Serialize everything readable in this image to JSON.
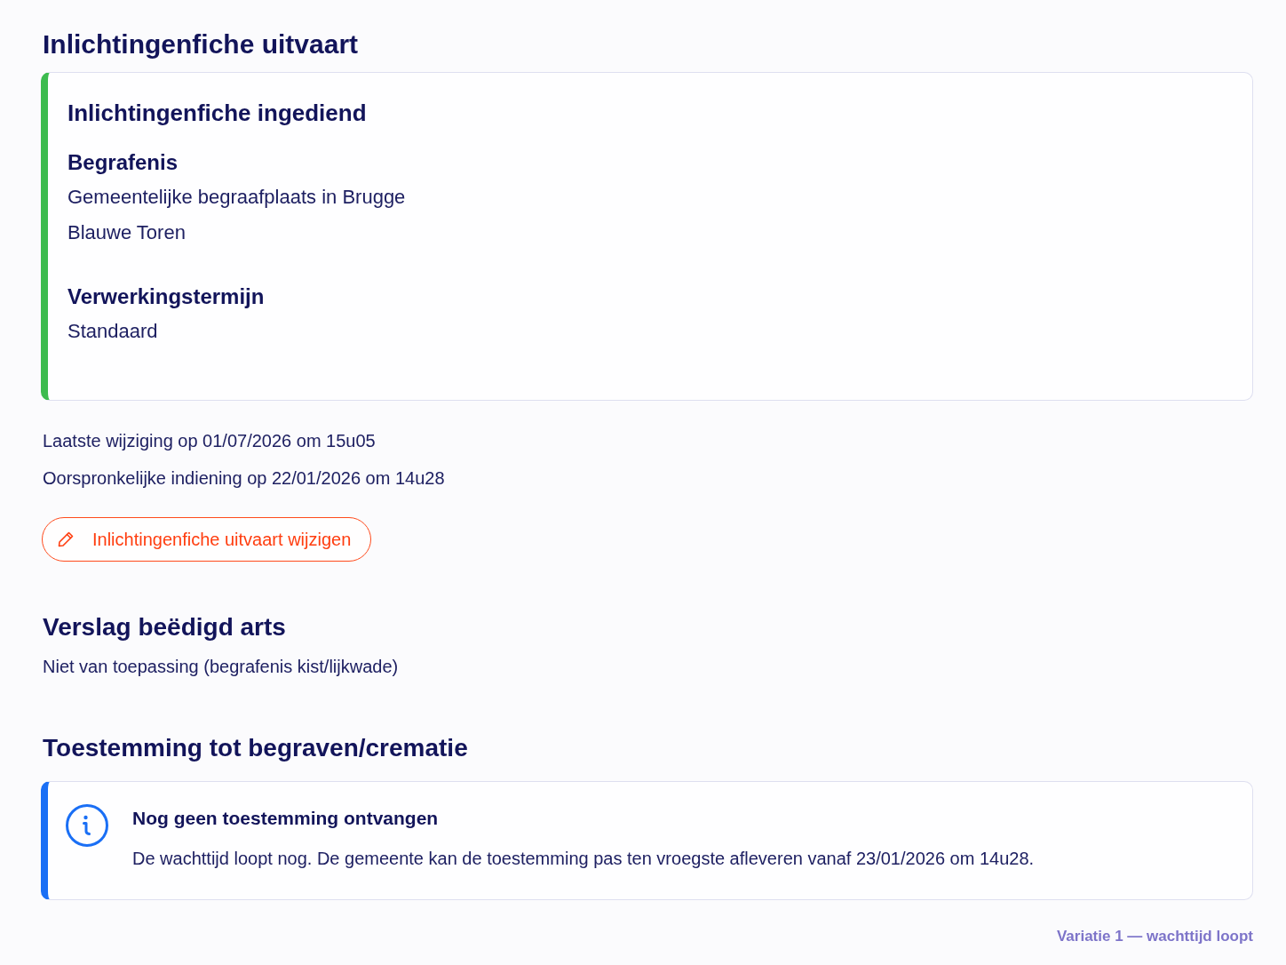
{
  "page": {
    "title": "Inlichtingenfiche uitvaart"
  },
  "submission_card": {
    "kind": "success",
    "title": "Inlichtingenfiche ingediend",
    "sections": [
      {
        "heading": "Begrafenis",
        "lines": [
          "Gemeentelijke begraafplaats in Brugge",
          "Blauwe Toren"
        ]
      },
      {
        "heading": "Verwerkingstermijn",
        "lines": [
          "Standaard"
        ]
      }
    ]
  },
  "meta": [
    "Laatste wijziging op 01/07/2026 om 15u05",
    "Oorspronkelijke indiening op 22/01/2026 om 14u28"
  ],
  "edit_button": {
    "label": "Inlichtingenfiche uitvaart wijzigen"
  },
  "sections": [
    {
      "heading": "Verslag beëdigd arts",
      "text": "Niet van toepassing (begrafenis kist/lijkwade)"
    },
    {
      "heading": "Toestemming tot begraven/crematie",
      "alert": {
        "kind": "info",
        "title": "Nog geen toestemming ontvangen",
        "text": "De wachttijd loopt nog. De gemeente kan de toestemming pas ten vroegste afleveren vanaf 23/01/2026 om 14u28."
      }
    }
  ],
  "footer_note": "Variatie 1 — wachttijd loopt"
}
